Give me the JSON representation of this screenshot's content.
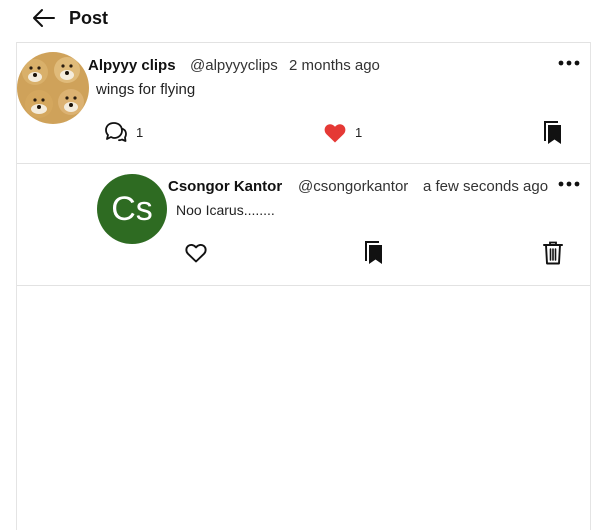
{
  "header": {
    "title": "Post",
    "back_icon": "arrow-left-icon"
  },
  "post": {
    "author_name": "Alpyyy clips",
    "author_handle": "@alpyyyclips",
    "timestamp": "2 months ago",
    "text": "wings for flying",
    "reply_count": "1",
    "like_count": "1",
    "liked": true,
    "like_color": "#e53935",
    "icons": {
      "reply": "speech-bubbles-icon",
      "like": "heart-filled-icon",
      "bookmark": "bookmark-icon",
      "more": "more-dots-icon"
    }
  },
  "reply": {
    "avatar_initials": "Cs",
    "avatar_color": "#2e6b22",
    "author_name": "Csongor Kantor",
    "author_handle": "@csongorkantor",
    "timestamp": "a few seconds ago",
    "text": "Noo Icarus........",
    "icons": {
      "like": "heart-outline-icon",
      "bookmark": "bookmark-icon",
      "delete": "trash-icon",
      "more": "more-dots-icon"
    }
  }
}
